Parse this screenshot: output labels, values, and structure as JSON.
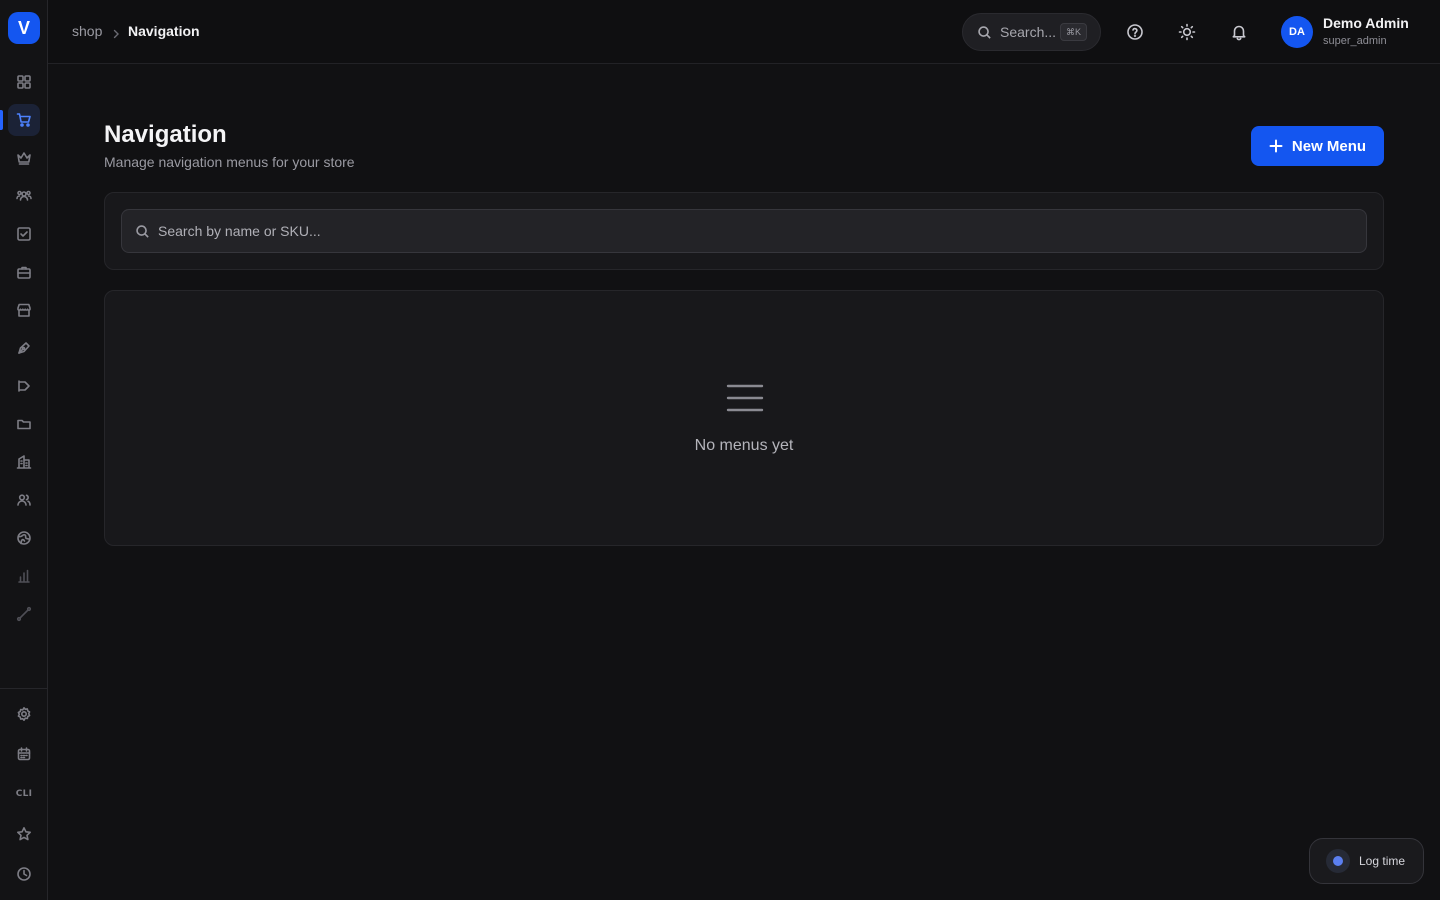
{
  "app": {
    "logo_letter": "V",
    "accent_color": "#1456f0"
  },
  "sidebar": {
    "items": [
      {
        "name": "dashboard-icon",
        "active": false
      },
      {
        "name": "shopping-cart-icon",
        "active": true
      },
      {
        "name": "crown-icon",
        "active": false
      },
      {
        "name": "users-group-icon",
        "active": false
      },
      {
        "name": "checkbox-icon",
        "active": false
      },
      {
        "name": "briefcase-icon",
        "active": false
      },
      {
        "name": "storefront-icon",
        "active": false
      },
      {
        "name": "pen-tool-icon",
        "active": false
      },
      {
        "name": "megaphone-icon",
        "active": false
      },
      {
        "name": "folder-icon",
        "active": false
      },
      {
        "name": "building-icon",
        "active": false
      },
      {
        "name": "users-icon",
        "active": false
      },
      {
        "name": "globe-icon",
        "active": false
      },
      {
        "name": "bar-chart-icon",
        "active": false
      },
      {
        "name": "workflow-icon",
        "active": false
      }
    ],
    "bottom": {
      "settings": "gear-icon",
      "calendar": "calendar-icon",
      "cli_label": "CLI",
      "favorites": "star-icon",
      "history": "clock-icon"
    }
  },
  "header": {
    "breadcrumb": {
      "root": "shop",
      "current": "Navigation"
    },
    "search": {
      "placeholder": "Search...",
      "shortcut": "⌘K"
    },
    "user": {
      "initials": "DA",
      "name": "Demo Admin",
      "role": "super_admin"
    }
  },
  "main": {
    "title": "Navigation",
    "subtitle": "Manage navigation menus for your store",
    "new_button_label": "New Menu",
    "search_placeholder": "Search by name or SKU...",
    "empty_state": {
      "icon": "menu-lines-icon",
      "text": "No menus yet"
    }
  },
  "floating": {
    "log_time_label": "Log time"
  }
}
